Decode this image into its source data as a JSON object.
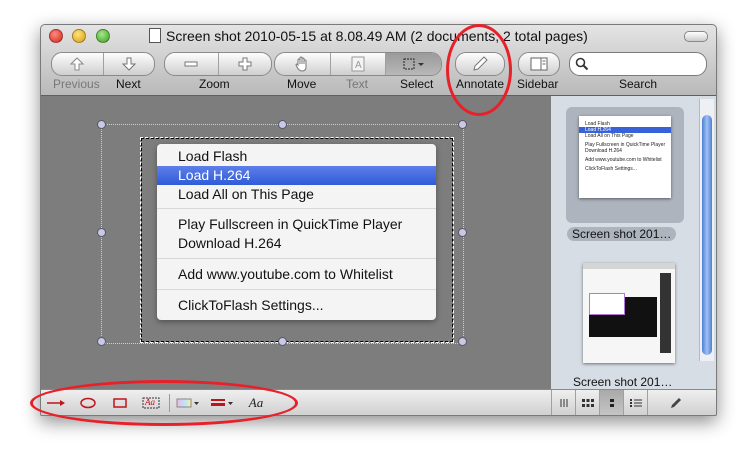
{
  "window": {
    "title": "Screen shot 2010-05-15 at 8.08.49 AM (2 documents, 2 total pages)"
  },
  "toolbar": {
    "previous_label": "Previous",
    "next_label": "Next",
    "zoom_label": "Zoom",
    "move_label": "Move",
    "text_label": "Text",
    "select_label": "Select",
    "annotate_label": "Annotate",
    "sidebar_label": "Sidebar",
    "search_label": "Search",
    "search_placeholder": ""
  },
  "context_menu": {
    "items": [
      "Load Flash",
      "Load H.264",
      "Load All on This Page",
      "Play Fullscreen in QuickTime Player",
      "Download H.264",
      "Add www.youtube.com to Whitelist",
      "ClickToFlash Settings..."
    ],
    "selected_index": 1
  },
  "sidebar": {
    "thumbnails": [
      {
        "caption": "Screen shot 201…",
        "selected": true
      },
      {
        "caption": "Screen shot 201…",
        "selected": false
      }
    ]
  },
  "annotation_bar": {
    "text_tool_label": "Aa",
    "text_box_label": "Aa",
    "accent_color": "#c0141c"
  },
  "highlight_color": "#e8202a"
}
